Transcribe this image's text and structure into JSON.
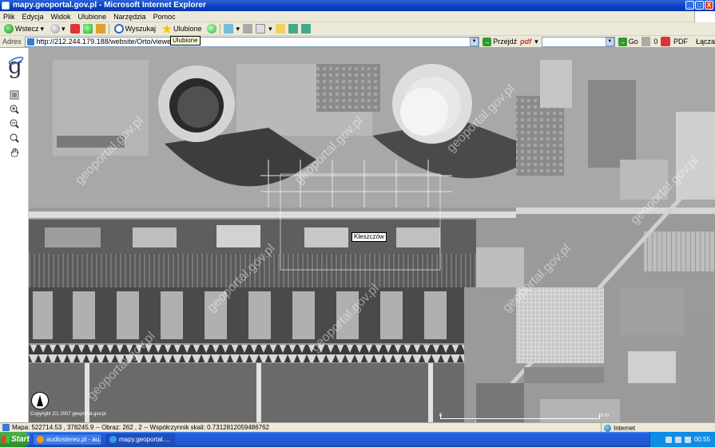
{
  "window": {
    "title": "mapy.geoportal.gov.pl - Microsoft Internet Explorer",
    "controls": [
      "_",
      "□",
      "X"
    ]
  },
  "menu": {
    "items": [
      "Plik",
      "Edycja",
      "Widok",
      "Ulubione",
      "Narzędzia",
      "Pomoc"
    ]
  },
  "toolbar": {
    "back_label": "Wstecz",
    "search_label": "Wyszukaj",
    "favorites_label": "Ulubione",
    "tooltip": "Ulubione"
  },
  "address": {
    "label": "Adres",
    "url": "http://212.244.179.188/website/Orto/viewer.htm",
    "go_label": "Przejdź",
    "pdf_label": "pdf",
    "go2_label": "Go",
    "counter": "0",
    "pdf2_label": "PDF",
    "links_label": "Łącza"
  },
  "map": {
    "place_label": "Kleszczów",
    "watermark": "geoportal.gov.pl",
    "copyright": "Copyright (C) 2007 geoportal.gov.pl",
    "scale_labels": [
      "0",
      "10 m"
    ]
  },
  "status": {
    "text": "Mapa: 522714.53 , 378245.9 -- Obraz: 262 , 2 -- Współczynnik skali: 0.7312812059486762",
    "zone": "Internet"
  },
  "taskbar": {
    "start_label": "Start",
    "tasks": [
      {
        "label": "audiostereo.pl - au...",
        "active": false
      },
      {
        "label": "mapy.geoportal....",
        "active": true
      }
    ],
    "clock": "00:55"
  }
}
